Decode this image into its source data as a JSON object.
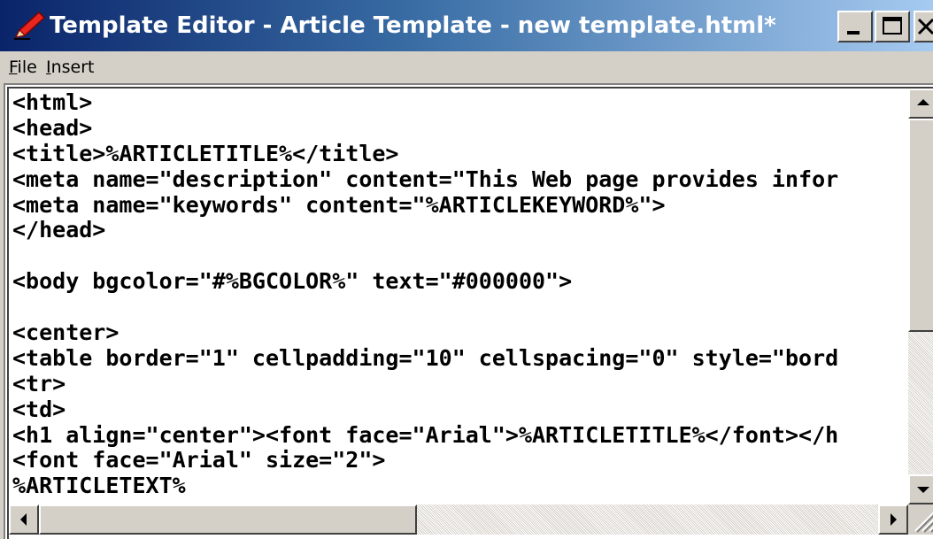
{
  "window": {
    "title": "Template Editor - Article Template - new template.html*",
    "icon": "pencil-icon",
    "controls": {
      "minimize": "minimize-icon",
      "maximize": "maximize-icon",
      "close": "close-icon"
    }
  },
  "menu": [
    {
      "label": "File",
      "accel": "F",
      "rest": "ile"
    },
    {
      "label": "Insert",
      "accel": "I",
      "rest": "nsert"
    }
  ],
  "editor": {
    "lines": [
      "<html>",
      "<head>",
      "<title>%ARTICLETITLE%</title>",
      "<meta name=\"description\" content=\"This Web page provides infor",
      "<meta name=\"keywords\" content=\"%ARTICLEKEYWORD%\">",
      "</head>",
      "",
      "<body bgcolor=\"#%BGCOLOR%\" text=\"#000000\">",
      "",
      "<center>",
      "<table border=\"1\" cellpadding=\"10\" cellspacing=\"0\" style=\"bord",
      "<tr>",
      "<td>",
      "<h1 align=\"center\"><font face=\"Arial\">%ARTICLETITLE%</font></h",
      "<font face=\"Arial\" size=\"2\">",
      "%ARTICLETEXT%"
    ]
  },
  "scrollbars": {
    "vertical_position": 0,
    "vertical_visible_fraction": 0.6,
    "horizontal_position": 0,
    "horizontal_visible_fraction": 0.45
  },
  "colors": {
    "titlebar_start": "#0a246a",
    "titlebar_end": "#a6caf0",
    "chrome": "#d4d0c8"
  }
}
